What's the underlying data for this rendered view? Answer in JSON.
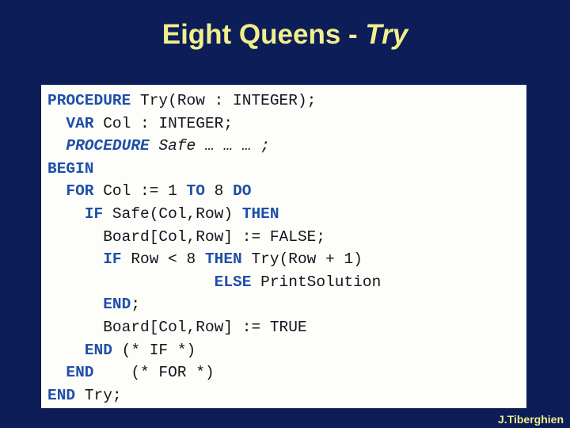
{
  "slide": {
    "title_main": "Eight Queens - ",
    "title_emphasis": "Try",
    "background_color": "#0c1d58",
    "title_color": "#f0ef8c"
  },
  "code": {
    "panel_background": "#fdfdfa",
    "keyword_color": "#1f4fa8",
    "text_color": "#14141c",
    "language": "Modula-2",
    "lines": [
      {
        "indent": 0,
        "italic": false,
        "tokens": [
          {
            "text": "PROCEDURE",
            "type": "keyword"
          },
          {
            "text": " Try(Row : INTEGER);",
            "type": "plain"
          }
        ]
      },
      {
        "indent": 2,
        "italic": false,
        "tokens": [
          {
            "text": "VAR",
            "type": "keyword"
          },
          {
            "text": " Col : INTEGER;",
            "type": "plain"
          }
        ]
      },
      {
        "indent": 2,
        "italic": true,
        "tokens": [
          {
            "text": "PROCEDURE",
            "type": "keyword"
          },
          {
            "text": " Safe … … … ;",
            "type": "plain"
          }
        ]
      },
      {
        "indent": 0,
        "italic": false,
        "tokens": [
          {
            "text": "BEGIN",
            "type": "keyword"
          }
        ]
      },
      {
        "indent": 2,
        "italic": false,
        "tokens": [
          {
            "text": "FOR",
            "type": "keyword"
          },
          {
            "text": " Col := 1 ",
            "type": "plain"
          },
          {
            "text": "TO",
            "type": "keyword"
          },
          {
            "text": " 8 ",
            "type": "plain"
          },
          {
            "text": "DO",
            "type": "keyword"
          }
        ]
      },
      {
        "indent": 4,
        "italic": false,
        "tokens": [
          {
            "text": "IF",
            "type": "keyword"
          },
          {
            "text": " Safe(Col,Row) ",
            "type": "plain"
          },
          {
            "text": "THEN",
            "type": "keyword"
          }
        ]
      },
      {
        "indent": 6,
        "italic": false,
        "tokens": [
          {
            "text": "Board[Col,Row] := FALSE;",
            "type": "plain"
          }
        ]
      },
      {
        "indent": 6,
        "italic": false,
        "tokens": [
          {
            "text": "IF",
            "type": "keyword"
          },
          {
            "text": " Row < 8 ",
            "type": "plain"
          },
          {
            "text": "THEN",
            "type": "keyword"
          },
          {
            "text": " Try(Row + 1)",
            "type": "plain"
          }
        ]
      },
      {
        "indent": 18,
        "italic": false,
        "tokens": [
          {
            "text": "ELSE",
            "type": "keyword"
          },
          {
            "text": " PrintSolution",
            "type": "plain"
          }
        ]
      },
      {
        "indent": 6,
        "italic": false,
        "tokens": [
          {
            "text": "END",
            "type": "keyword"
          },
          {
            "text": ";",
            "type": "plain"
          }
        ]
      },
      {
        "indent": 6,
        "italic": false,
        "tokens": [
          {
            "text": "Board[Col,Row] := TRUE",
            "type": "plain"
          }
        ]
      },
      {
        "indent": 4,
        "italic": false,
        "tokens": [
          {
            "text": "END",
            "type": "keyword"
          },
          {
            "text": " (* IF *)",
            "type": "plain"
          }
        ]
      },
      {
        "indent": 2,
        "italic": false,
        "tokens": [
          {
            "text": "END",
            "type": "keyword"
          },
          {
            "text": "    (* FOR *)",
            "type": "plain"
          }
        ]
      },
      {
        "indent": 0,
        "italic": false,
        "tokens": [
          {
            "text": "END",
            "type": "keyword"
          },
          {
            "text": " Try;",
            "type": "plain"
          }
        ]
      }
    ]
  },
  "footer": {
    "credit": "J.Tiberghien",
    "color": "#eeee88"
  }
}
